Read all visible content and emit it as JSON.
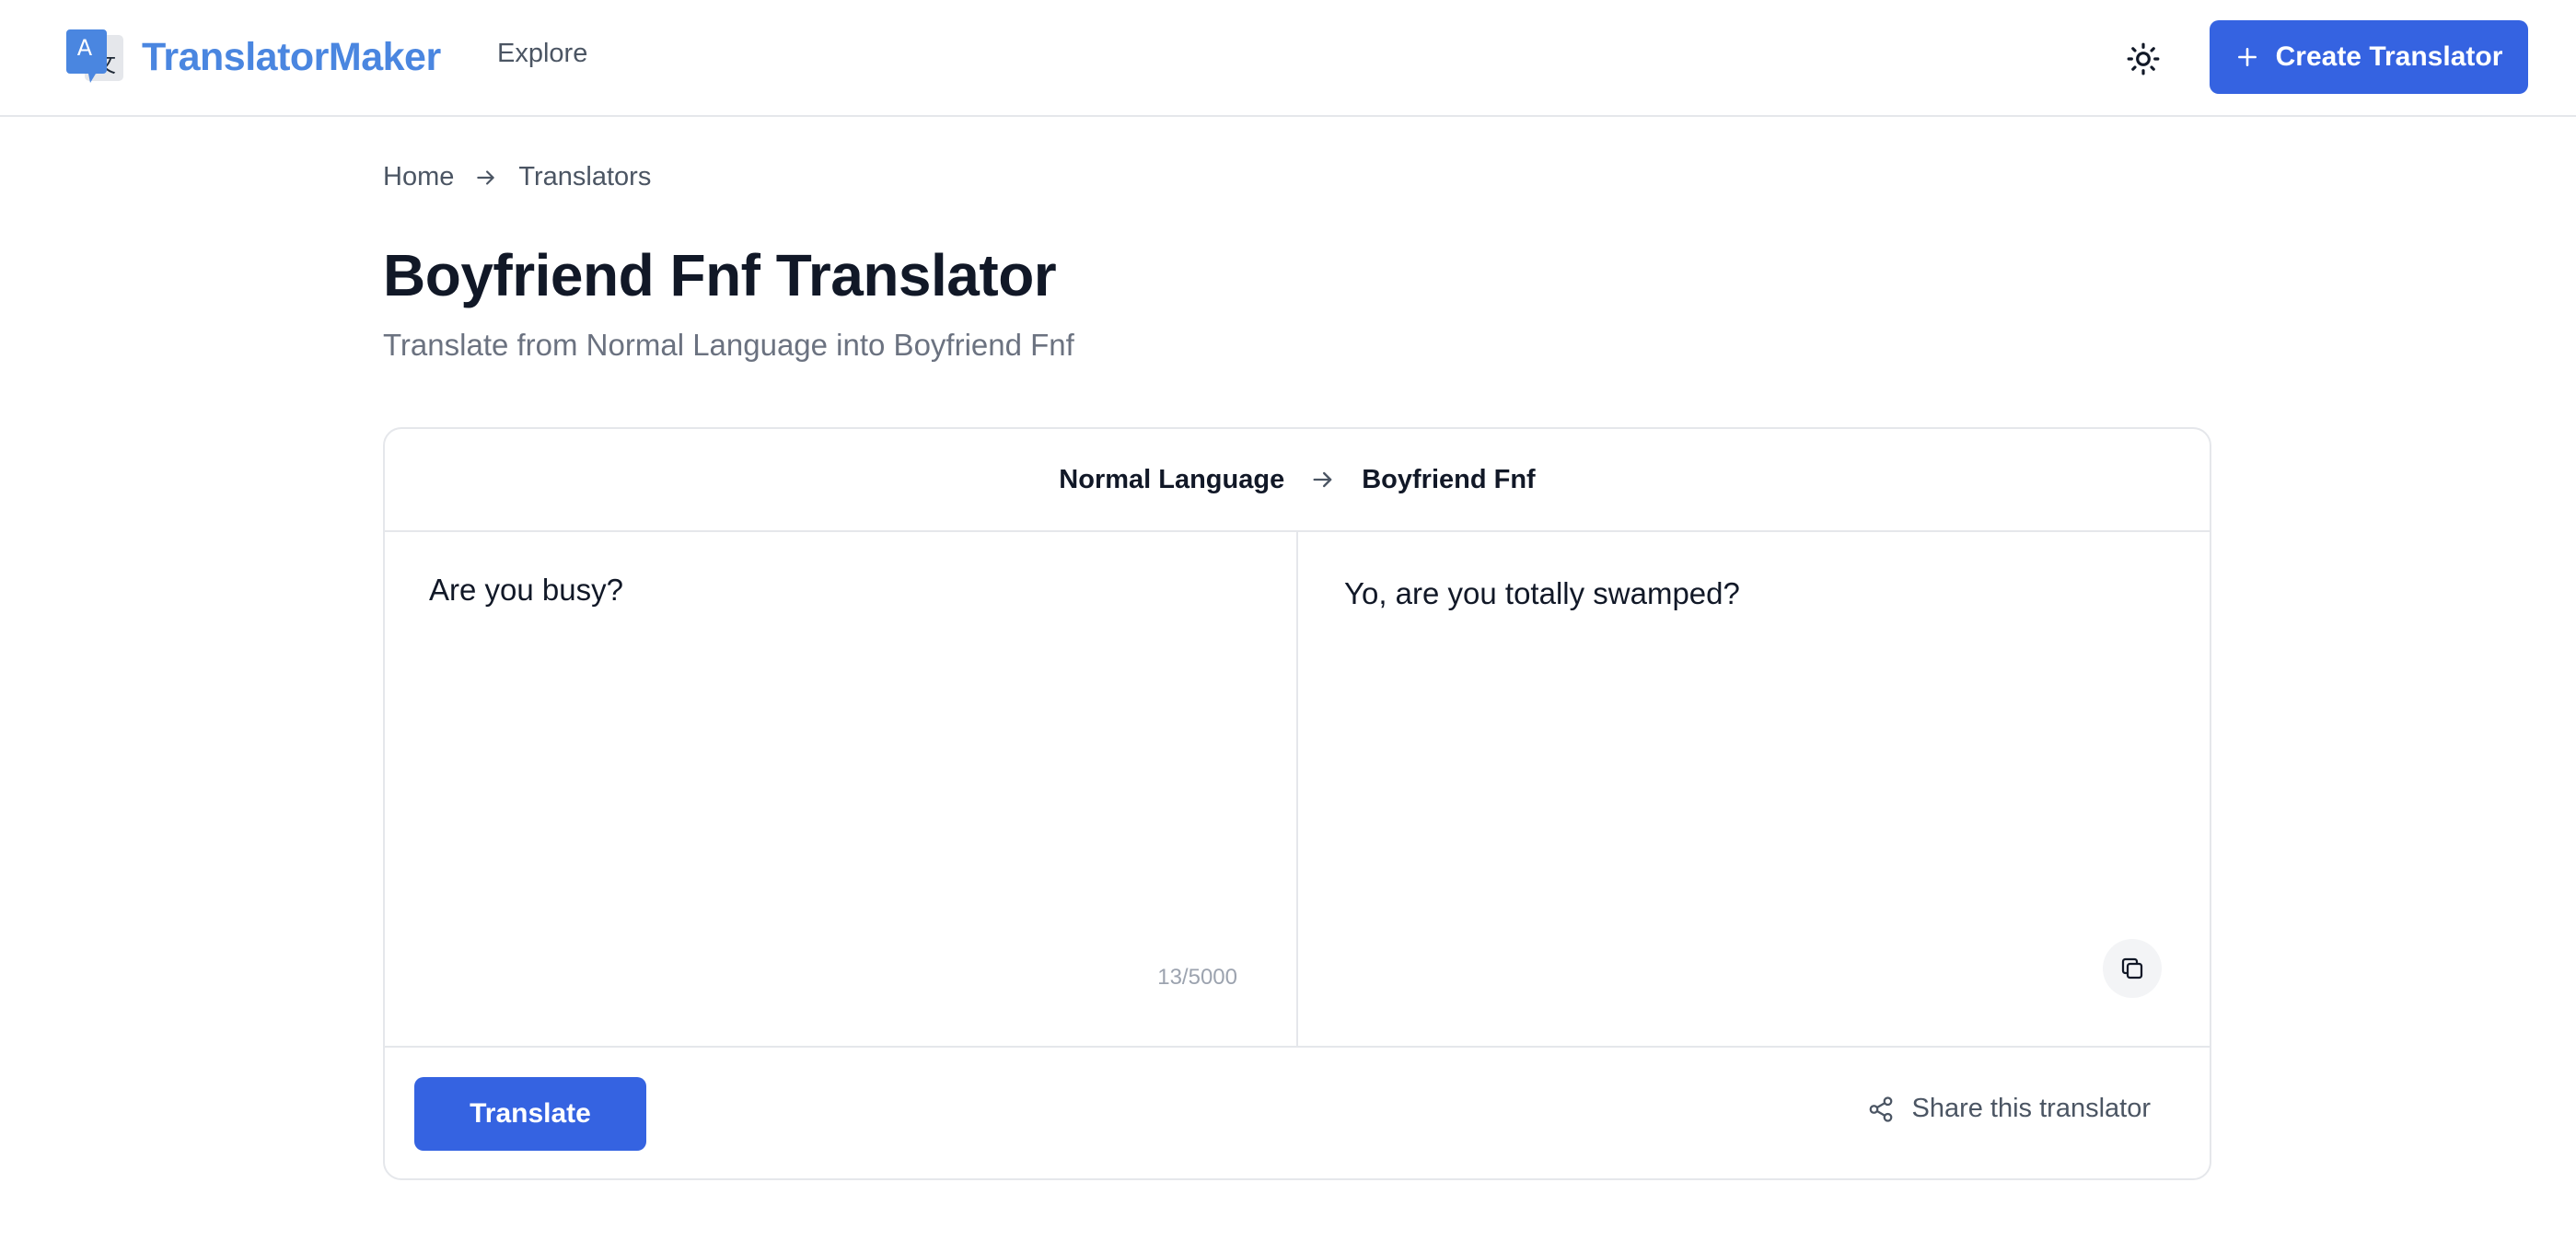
{
  "header": {
    "logo_text": "TranslatorMaker",
    "logo_glyph_latin": "A",
    "logo_glyph_cjk": "文",
    "nav": {
      "explore_label": "Explore"
    },
    "theme_toggle_icon": "sun-icon",
    "create_button": {
      "label": "Create Translator",
      "icon": "plus-icon"
    }
  },
  "breadcrumb": {
    "home_label": "Home",
    "separator_icon": "arrow-right-icon",
    "current_label": "Translators"
  },
  "page": {
    "title": "Boyfriend Fnf Translator",
    "subtitle": "Translate from Normal Language into Boyfriend Fnf"
  },
  "translator": {
    "source_language": "Normal Language",
    "target_language": "Boyfriend Fnf",
    "direction_icon": "arrow-right-icon",
    "input_text": "Are you busy?",
    "char_count": "13/5000",
    "output_text": "Yo, are you totally swamped?",
    "copy_icon": "copy-icon",
    "translate_button_label": "Translate",
    "share_label": "Share this translator",
    "share_icon": "share-icon"
  },
  "colors": {
    "brand_blue": "#3563e1",
    "logo_blue": "#4a86e0",
    "border": "#e5e7eb",
    "muted_text": "#6b7280"
  }
}
